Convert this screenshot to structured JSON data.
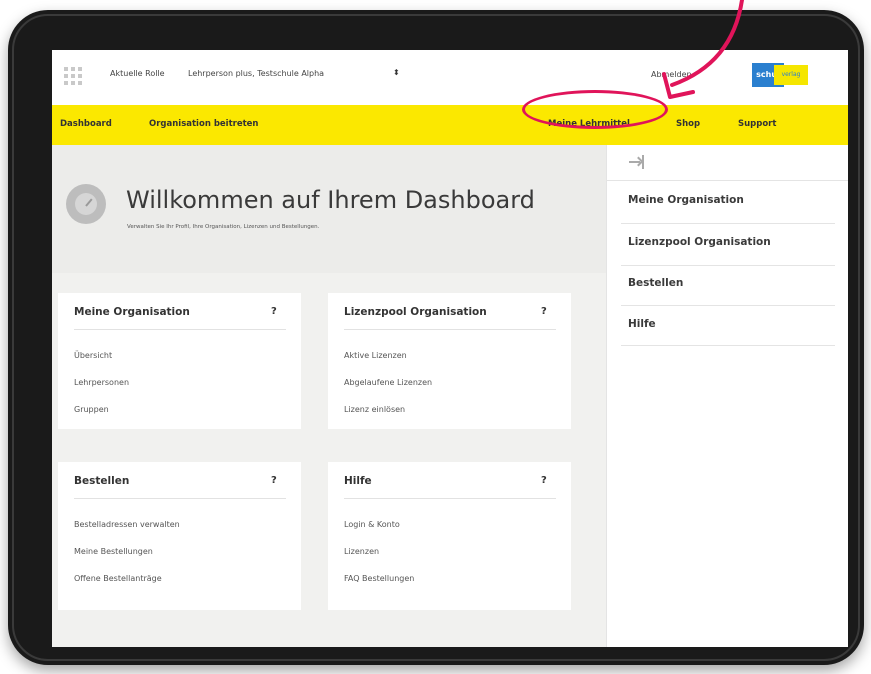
{
  "topbar": {
    "role_label": "Aktuelle Rolle",
    "role_value": "Lehrperson plus, Testschule Alpha",
    "role_arrow": "⬍",
    "logout": "Abmelden",
    "logo_text_blue": "schul",
    "logo_text_yellow": "verlag"
  },
  "nav": {
    "items": [
      {
        "label": "Dashboard"
      },
      {
        "label": "Organisation beitreten"
      },
      {
        "label": "Meine Lehrmittel"
      },
      {
        "label": "Shop"
      },
      {
        "label": "Support"
      }
    ]
  },
  "welcome": {
    "title": "Willkommen auf Ihrem Dashboard",
    "subtitle": "Verwalten Sie Ihr Profil, Ihre Organisation, Lizenzen und Bestellungen."
  },
  "cards": [
    {
      "title": "Meine Organisation",
      "help": "?",
      "links": [
        "Übersicht",
        "Lehrpersonen",
        "Gruppen"
      ]
    },
    {
      "title": "Lizenzpool Organisation",
      "help": "?",
      "links": [
        "Aktive Lizenzen",
        "Abgelaufene Lizenzen",
        "Lizenz einlösen"
      ]
    },
    {
      "title": "Bestellen",
      "help": "?",
      "links": [
        "Bestelladressen verwalten",
        "Meine Bestellungen",
        "Offene Bestellanträge"
      ]
    },
    {
      "title": "Hilfe",
      "help": "?",
      "links": [
        "Login & Konto",
        "Lizenzen",
        "FAQ Bestellungen"
      ]
    }
  ],
  "sidebar": {
    "items": [
      {
        "label": "Meine Organisation"
      },
      {
        "label": "Lizenzpool Organisation"
      },
      {
        "label": "Bestellen"
      },
      {
        "label": "Hilfe"
      }
    ]
  },
  "colors": {
    "nav_bg": "#fbe800",
    "annotation": "#e0145a",
    "logo_blue": "#2a7fcf"
  },
  "icons": [
    "apps-grid-icon",
    "dashboard-gauge-icon",
    "collapse-sidebar-icon"
  ]
}
